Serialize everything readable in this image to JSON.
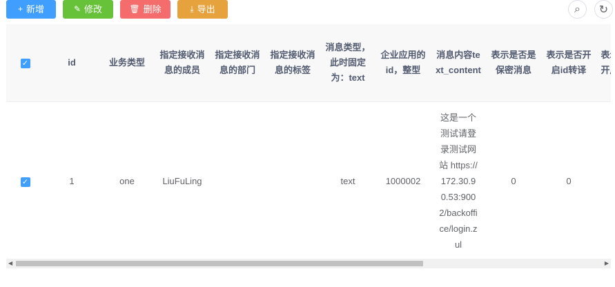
{
  "toolbar": {
    "add": {
      "icon": "+",
      "label": "新增"
    },
    "edit": {
      "icon": "✎",
      "label": "修改"
    },
    "delete": {
      "icon": "🗑",
      "label": "删除"
    },
    "export": {
      "icon": "⤓",
      "label": "导出"
    },
    "search_icon": "⌕",
    "refresh_icon": "↻"
  },
  "colors": {
    "primary": "#409eff",
    "success": "#67c23a",
    "danger": "#f56c6c",
    "warning": "#e6a23c"
  },
  "table": {
    "headers": {
      "id": "id",
      "biz_type": "业务类型",
      "member": "指定接收消息的成员",
      "dept": "指定接收消息的部门",
      "tag": "指定接收消息的标签",
      "msg_type": "消息类型，此时固定为：text",
      "agent_id": "企业应用的id，整型",
      "content": "消息内容text_content",
      "safe": "表示是否是保密消息",
      "id_trans": "表示是否开启id转译",
      "more": "表示是否开启消息"
    },
    "row": {
      "checked": "✓",
      "id": "1",
      "biz_type": "one",
      "member": "LiuFuLing",
      "dept": "",
      "tag": "",
      "msg_type": "text",
      "agent_id": "1000002",
      "content": "这是一个测试请登录测试网站 https://172.30.90.53:9002/backoffice/login.zul",
      "safe": "0",
      "id_trans": "0",
      "more": ""
    }
  }
}
